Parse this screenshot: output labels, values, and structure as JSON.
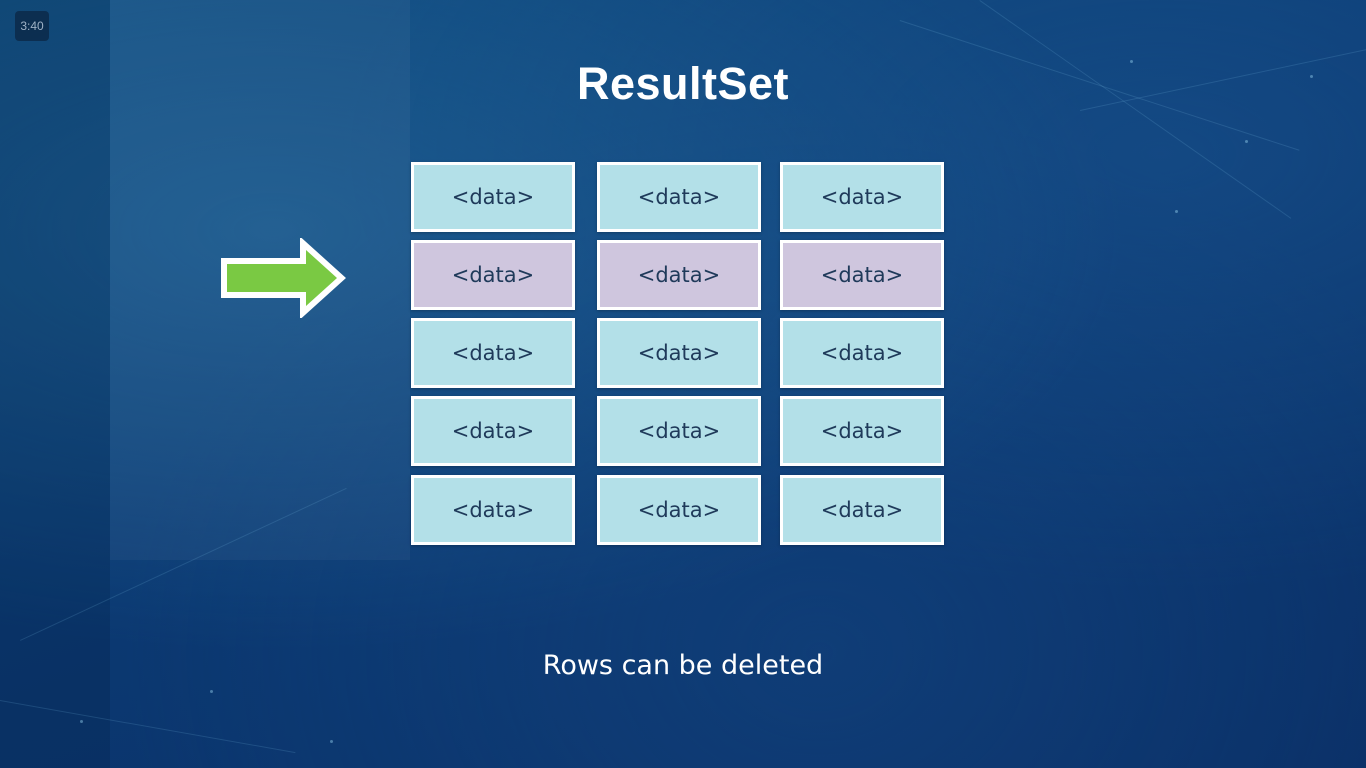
{
  "player": {
    "timecode": "3:40"
  },
  "slide": {
    "title": "ResultSet",
    "caption": "Rows can be deleted",
    "pointer": {
      "icon": "right-arrow-icon",
      "color": "#7ac943",
      "points_to_row": 2
    },
    "colors": {
      "cell": "#b3e0e8",
      "selected_cell": "#cfc6de",
      "cell_border": "#ffffff"
    },
    "rows": [
      {
        "selected": false,
        "cells": [
          "<data>",
          "<data>",
          "<data>"
        ]
      },
      {
        "selected": true,
        "cells": [
          "<data>",
          "<data>",
          "<data>"
        ]
      },
      {
        "selected": false,
        "cells": [
          "<data>",
          "<data>",
          "<data>"
        ]
      },
      {
        "selected": false,
        "cells": [
          "<data>",
          "<data>",
          "<data>"
        ]
      },
      {
        "selected": false,
        "cells": [
          "<data>",
          "<data>",
          "<data>"
        ]
      }
    ]
  }
}
